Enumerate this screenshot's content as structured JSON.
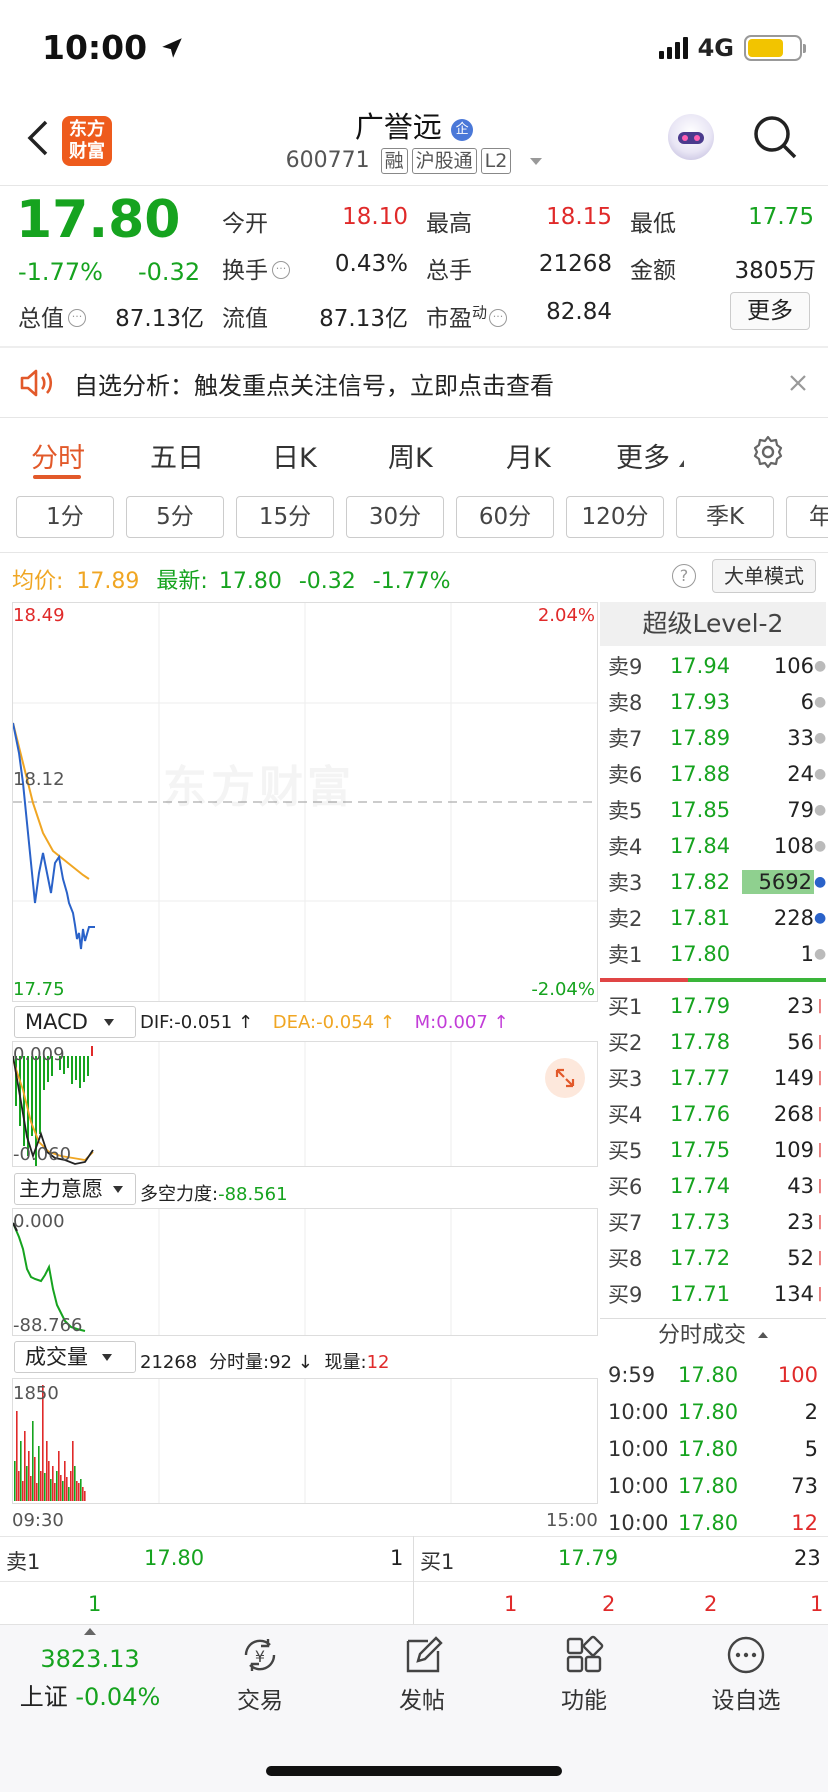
{
  "status": {
    "time": "10:00",
    "network": "4G"
  },
  "header": {
    "title": "广誉远",
    "code": "600771",
    "tags": [
      "融",
      "沪股通",
      "L2"
    ],
    "logo_text": "东方财富"
  },
  "quote": {
    "price": "17.80",
    "change_pct": "-1.77%",
    "change": "-0.32",
    "open_label": "今开",
    "open": "18.10",
    "high_label": "最高",
    "high": "18.15",
    "low_label": "最低",
    "low": "17.75",
    "turnover_label": "换手",
    "turnover": "0.43%",
    "volume_label": "总手",
    "volume": "21268",
    "amount_label": "金额",
    "amount": "3805万",
    "mktcap_label": "总值",
    "mktcap": "87.13亿",
    "float_label": "流值",
    "float": "87.13亿",
    "pe_label": "市盈",
    "pe_sup": "动",
    "pe": "82.84",
    "more": "更多"
  },
  "notice": {
    "text": "自选分析：触发重点关注信号，立即点击查看"
  },
  "tabs": [
    "分时",
    "五日",
    "日K",
    "周K",
    "月K",
    "更多"
  ],
  "intervals": [
    "1分",
    "5分",
    "15分",
    "30分",
    "60分",
    "120分",
    "季K",
    "年"
  ],
  "info_line": {
    "avg_label": "均价:",
    "avg": "17.89",
    "last_label": "最新:",
    "last": "17.80",
    "chg": "-0.32",
    "pct": "-1.77%",
    "mode_btn": "大单模式"
  },
  "chart": {
    "ymax": "18.49",
    "ymin": "17.75",
    "pmax": "2.04%",
    "pmin": "-2.04%",
    "prev_close": "18.12",
    "watermark": "东方财富",
    "time_start": "09:30",
    "time_end": "15:00",
    "colors": {
      "price": "#2a62c9",
      "avg": "#f0a623",
      "up": "#e02a2a",
      "down": "#16a31f"
    }
  },
  "macd": {
    "selector": "MACD",
    "dif_label": "DIF:",
    "dif": "-0.051 ↑",
    "dea_label": "DEA:",
    "dea": "-0.054 ↑",
    "m_label": "M:",
    "m": "0.007 ↑",
    "top": "0.009",
    "bottom": "-0.060"
  },
  "zlyy": {
    "selector": "主力意愿",
    "label": "多空力度:",
    "value": "-88.561",
    "top": "0.000",
    "bottom": "-88.766"
  },
  "vol": {
    "selector": "成交量",
    "total": "21268",
    "per_label": "分时量:",
    "per": "92 ↓",
    "now_label": "现量:",
    "now": "12",
    "top": "1850"
  },
  "orderbook": {
    "title": "超级Level-2",
    "asks": [
      {
        "label": "卖9",
        "price": "17.94",
        "vol": "106"
      },
      {
        "label": "卖8",
        "price": "17.93",
        "vol": "6"
      },
      {
        "label": "卖7",
        "price": "17.89",
        "vol": "33"
      },
      {
        "label": "卖6",
        "price": "17.88",
        "vol": "24"
      },
      {
        "label": "卖5",
        "price": "17.85",
        "vol": "79"
      },
      {
        "label": "卖4",
        "price": "17.84",
        "vol": "108"
      },
      {
        "label": "卖3",
        "price": "17.82",
        "vol": "5692"
      },
      {
        "label": "卖2",
        "price": "17.81",
        "vol": "228"
      },
      {
        "label": "卖1",
        "price": "17.80",
        "vol": "1"
      }
    ],
    "bids": [
      {
        "label": "买1",
        "price": "17.79",
        "vol": "23"
      },
      {
        "label": "买2",
        "price": "17.78",
        "vol": "56"
      },
      {
        "label": "买3",
        "price": "17.77",
        "vol": "149"
      },
      {
        "label": "买4",
        "price": "17.76",
        "vol": "268"
      },
      {
        "label": "买5",
        "price": "17.75",
        "vol": "109"
      },
      {
        "label": "买6",
        "price": "17.74",
        "vol": "43"
      },
      {
        "label": "买7",
        "price": "17.73",
        "vol": "23"
      },
      {
        "label": "买8",
        "price": "17.72",
        "vol": "52"
      },
      {
        "label": "买9",
        "price": "17.71",
        "vol": "134"
      }
    ],
    "ticks_title": "分时成交",
    "ticks": [
      {
        "time": "9:59",
        "price": "17.80",
        "vol": "100"
      },
      {
        "time": "10:00",
        "price": "17.80",
        "vol": "2"
      },
      {
        "time": "10:00",
        "price": "17.80",
        "vol": "5"
      },
      {
        "time": "10:00",
        "price": "17.80",
        "vol": "73"
      },
      {
        "time": "10:00",
        "price": "17.80",
        "vol": "12"
      }
    ]
  },
  "queue": {
    "ask_label": "卖1",
    "ask_price": "17.80",
    "ask_vol": "1",
    "bid_label": "买1",
    "bid_price": "17.79",
    "bid_vol": "23",
    "ask_q": [
      "1"
    ],
    "bid_q": [
      "1",
      "2",
      "2",
      "1"
    ]
  },
  "bottom_nav": {
    "index_value": "3823.13",
    "index_name": "上证",
    "index_pct": "-0.04%",
    "items": [
      "交易",
      "发帖",
      "功能",
      "设自选"
    ]
  }
}
